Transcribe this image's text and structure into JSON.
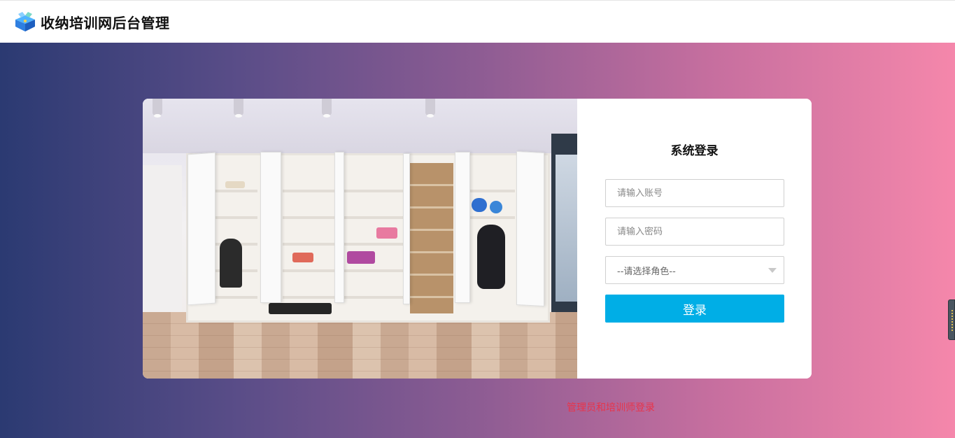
{
  "header": {
    "title": "收纳培训网后台管理",
    "logo_icon": "cube-box-logo-icon"
  },
  "login": {
    "title": "系统登录",
    "account_placeholder": "请输入账号",
    "password_placeholder": "请输入密码",
    "role_select_value": "--请选择角色--",
    "submit_label": "登录"
  },
  "footer_note": "管理员和培训师登录",
  "colors": {
    "gradient_start": "#2b3a72",
    "gradient_end": "#f587ab",
    "button": "#00aee6",
    "note": "#e8344a"
  }
}
